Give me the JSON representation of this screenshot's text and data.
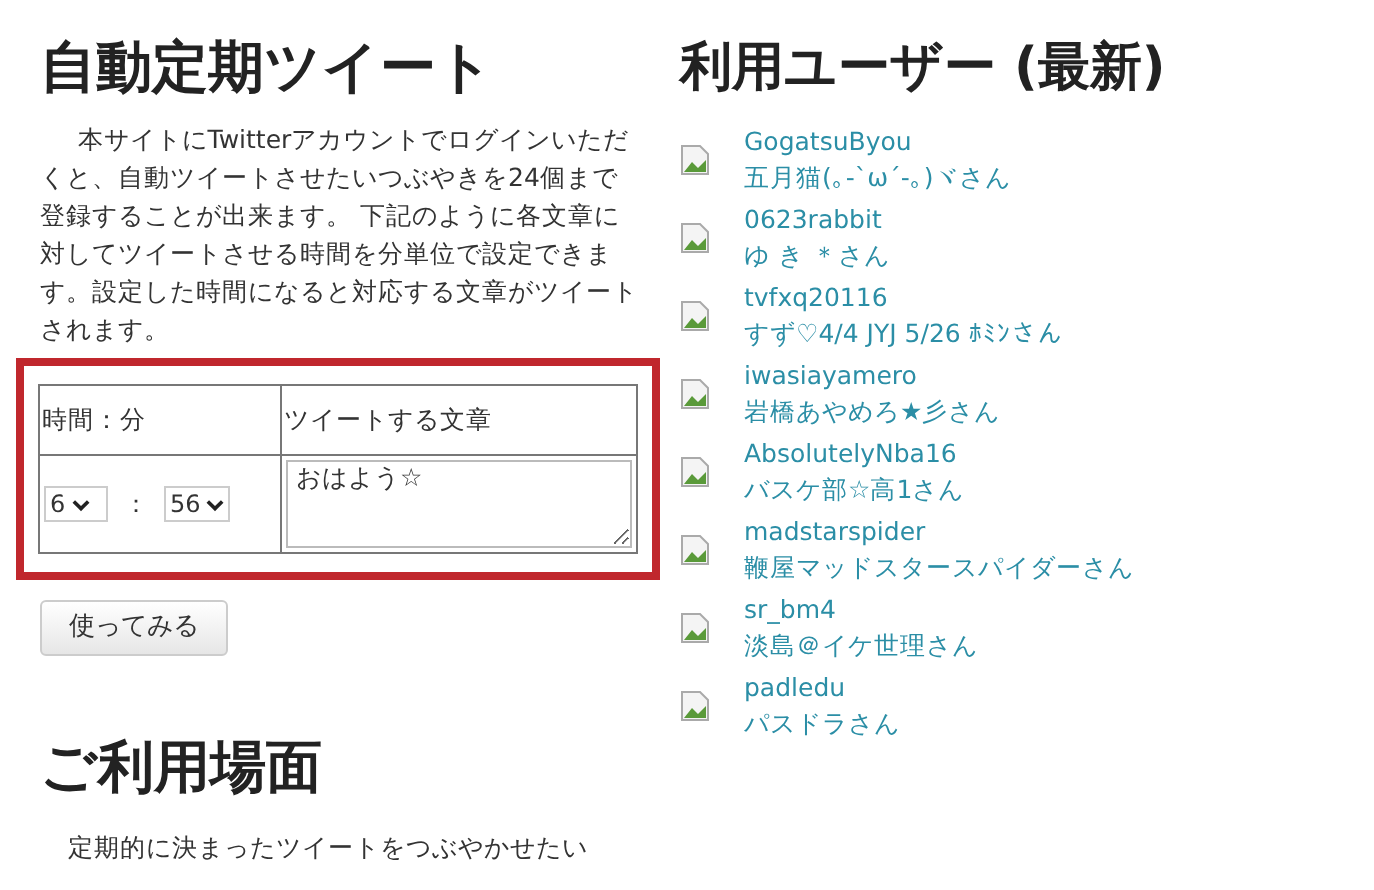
{
  "main": {
    "heading": "自動定期ツイート",
    "intro": "本サイトにTwitterアカウントでログインいただくと、自動ツイートさせたいつぶやきを24個まで登録することが出来ます。 下記のように各文章に対してツイートさせる時間を分単位で設定できます。設定した時間になると対応する文章がツイートされます。",
    "table": {
      "columns": [
        "時間：分",
        "ツイートする文章"
      ],
      "hour": "6",
      "separator": "：",
      "minute": "56",
      "tweet": "おはよう☆"
    },
    "try_button": "使ってみる",
    "usage_heading": "ご利用場面",
    "usage_text": "定期的に決まったツイートをつぶやかせたい"
  },
  "sidebar": {
    "heading": "利用ユーザー (最新)",
    "users": [
      {
        "username": "GogatsuByou",
        "display": "五月猫(｡-`ω´-｡)ヾさん"
      },
      {
        "username": "0623rabbit",
        "display": "ゆ き ＊さん"
      },
      {
        "username": "tvfxq20116",
        "display": "すず♡4/4 JYJ 5/26 ﾎﾐﾝさん"
      },
      {
        "username": "iwasiayamero",
        "display": "岩橋あやめろ★彡さん"
      },
      {
        "username": "AbsolutelyNba16",
        "display": "バスケ部☆高1さん"
      },
      {
        "username": "madstarspider",
        "display": "鞭屋マッドスタースパイダーさん"
      },
      {
        "username": "sr_bm4",
        "display": "淡島＠イケ世理さん"
      },
      {
        "username": "padledu",
        "display": "パスドラさん"
      }
    ]
  }
}
